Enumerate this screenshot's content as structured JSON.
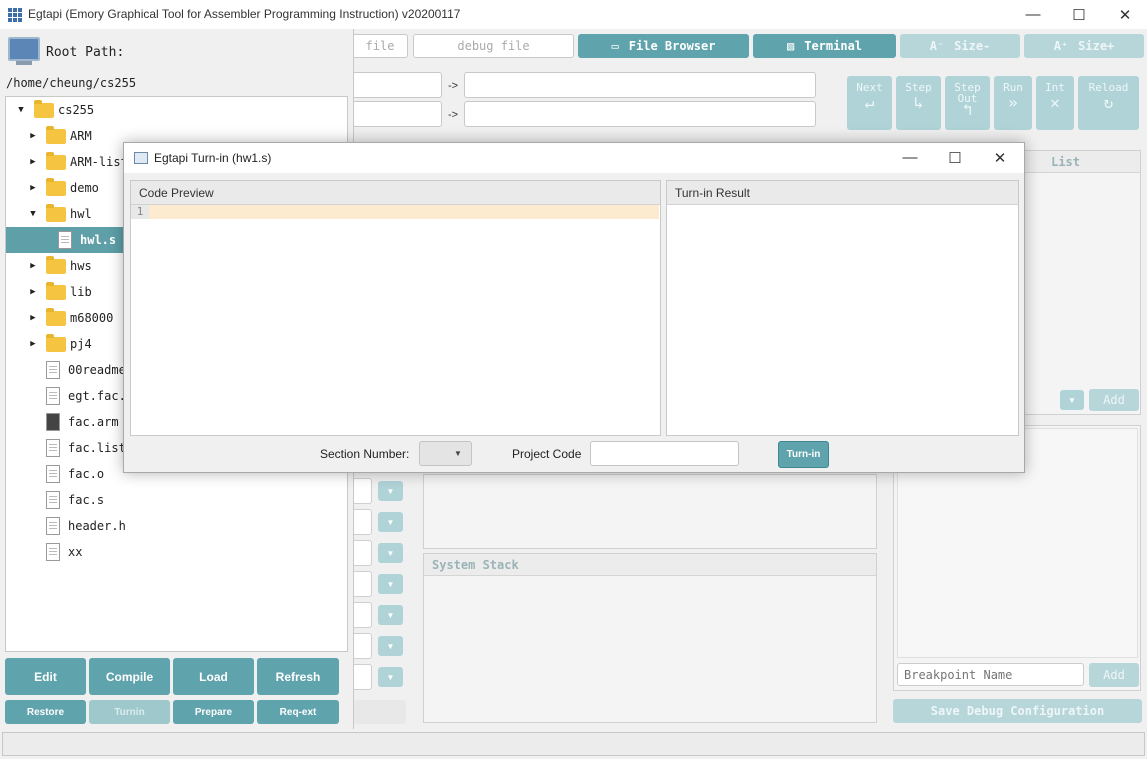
{
  "window": {
    "title": "Egtapi (Emory Graphical Tool for Assembler Programming Instruction) v20200117",
    "minimize_icon": "minimize-icon",
    "maximize_icon": "maximize-icon",
    "close_icon": "close-icon"
  },
  "toolbar": {
    "file_field": "file",
    "debug_file_placeholder": "debug file",
    "file_browser_label": "File Browser",
    "terminal_label": "Terminal",
    "size_minus_label": "Size-",
    "size_plus_label": "Size+",
    "accent_color": "#5fa3ac"
  },
  "arrows": [
    "->",
    "->"
  ],
  "debug_buttons": [
    {
      "line1": "Next",
      "line2": "",
      "icon": "next-icon"
    },
    {
      "line1": "Step",
      "line2": "",
      "icon": "step-icon"
    },
    {
      "line1": "Step",
      "line2": "Out",
      "icon": "step-out-icon"
    },
    {
      "line1": "Run",
      "line2": "",
      "icon": "run-icon"
    },
    {
      "line1": "Int",
      "line2": "",
      "icon": "interrupt-icon"
    },
    {
      "line1": "Reload",
      "line2": "",
      "icon": "reload-icon"
    }
  ],
  "right_panel": {
    "list_header": "List",
    "add_label": "Add",
    "breakpoint_placeholder": "Breakpoint Name",
    "add_breakpoint_label": "Add",
    "save_config_label": "Save Debug Configuration"
  },
  "center": {
    "system_stack_header": "System Stack"
  },
  "file_browser": {
    "root_label": "Root Path:",
    "root_path": "/home/cheung/cs255",
    "tree": [
      {
        "name": "cs255",
        "kind": "folder",
        "level": 0,
        "expanded": true
      },
      {
        "name": "ARM",
        "kind": "folder",
        "level": 1,
        "expanded": false
      },
      {
        "name": "ARM-list",
        "kind": "folder",
        "level": 1,
        "expanded": false
      },
      {
        "name": "demo",
        "kind": "folder",
        "level": 1,
        "expanded": false
      },
      {
        "name": "hwl",
        "kind": "folder",
        "level": 1,
        "expanded": true
      },
      {
        "name": "hwl.s",
        "kind": "file",
        "level": 2,
        "selected": true
      },
      {
        "name": "hws",
        "kind": "folder",
        "level": 1,
        "expanded": false
      },
      {
        "name": "lib",
        "kind": "folder",
        "level": 1,
        "expanded": false
      },
      {
        "name": "m68000",
        "kind": "folder",
        "level": 1,
        "expanded": false
      },
      {
        "name": "pj4",
        "kind": "folder",
        "level": 1,
        "expanded": false
      },
      {
        "name": "00readme",
        "kind": "file",
        "level": 1
      },
      {
        "name": "egt.fac.",
        "kind": "file",
        "level": 1
      },
      {
        "name": "fac.arm",
        "kind": "binary",
        "level": 1
      },
      {
        "name": "fac.list",
        "kind": "file",
        "level": 1
      },
      {
        "name": "fac.o",
        "kind": "file",
        "level": 1
      },
      {
        "name": "fac.s",
        "kind": "file",
        "level": 1
      },
      {
        "name": "header.h",
        "kind": "file",
        "level": 1
      },
      {
        "name": "xx",
        "kind": "file",
        "level": 1
      }
    ],
    "buttons_row1": [
      "Edit",
      "Compile",
      "Load",
      "Refresh"
    ],
    "buttons_row2": [
      "Restore",
      "Turnin",
      "Prepare",
      "Req-ext"
    ]
  },
  "dialog": {
    "title": "Egtapi Turn-in (hw1.s)",
    "code_preview_header": "Code Preview",
    "turnin_result_header": "Turn-in Result",
    "line_number": "1",
    "section_number_label": "Section Number:",
    "section_number_value": "",
    "project_code_label": "Project Code",
    "project_code_value": "",
    "turnin_button": "Turn-in"
  }
}
